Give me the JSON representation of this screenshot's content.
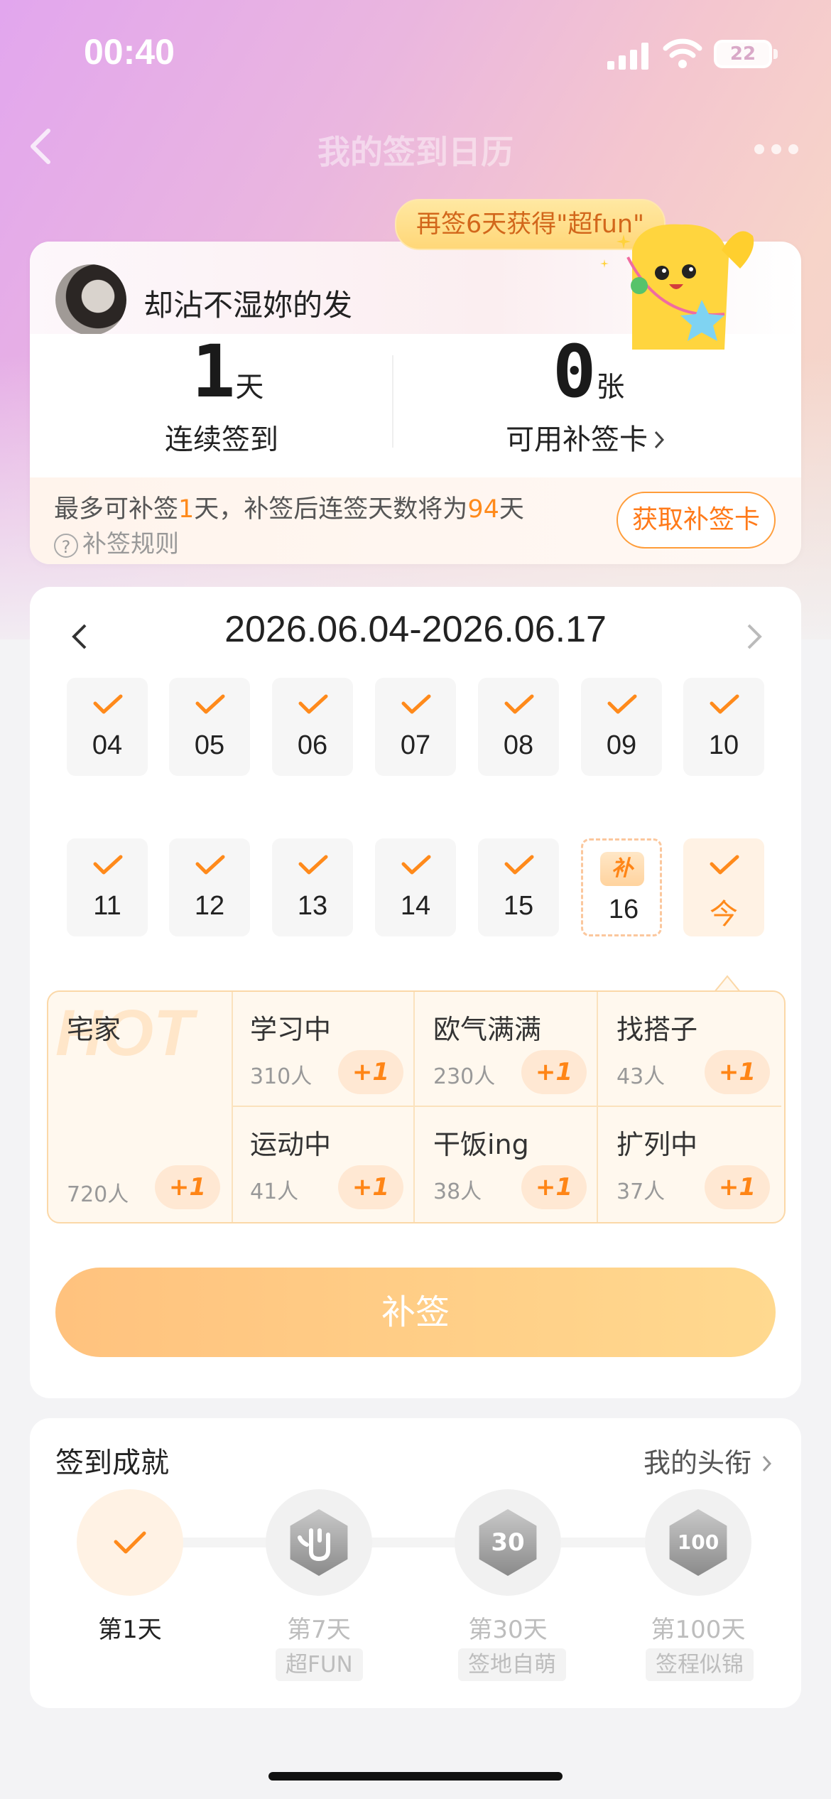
{
  "status_bar": {
    "time": "00:40",
    "battery": "22"
  },
  "nav": {
    "title": "我的签到日历"
  },
  "banner": {
    "tip": "再签6天获得\"超fun\""
  },
  "profile": {
    "username": "却沾不湿妳的发",
    "streak_value": "1",
    "streak_unit": "天",
    "streak_label": "连续签到",
    "cards_value": "0",
    "cards_unit": "张",
    "cards_label": "可用补签卡",
    "repair_pre": "最多可补签",
    "repair_days": "1",
    "repair_mid": "天，补签后连签天数将为",
    "repair_total": "94",
    "repair_post": "天",
    "rule_label": "补签规则",
    "get_card_button": "获取补签卡"
  },
  "calendar": {
    "range": "2026.06.04-2026.06.17",
    "week1": [
      "04",
      "05",
      "06",
      "07",
      "08",
      "09",
      "10"
    ],
    "week2": [
      "11",
      "12",
      "13",
      "14",
      "15"
    ],
    "missing_day": "16",
    "missing_badge": "补",
    "today_label": "今"
  },
  "tags": {
    "hot_word": "HOT",
    "hot": {
      "name": "宅家",
      "count": "720人"
    },
    "items": [
      {
        "name": "学习中",
        "count": "310人"
      },
      {
        "name": "欧气满满",
        "count": "230人"
      },
      {
        "name": "找搭子",
        "count": "43人"
      },
      {
        "name": "运动中",
        "count": "41人"
      },
      {
        "name": "干饭ing",
        "count": "38人"
      },
      {
        "name": "扩列中",
        "count": "37人"
      }
    ],
    "plus_label": "+1"
  },
  "buqian_button": "补签",
  "achievements": {
    "title": "签到成就",
    "link": "我的头衔",
    "items": [
      {
        "day": "第1天",
        "name": ""
      },
      {
        "day": "第7天",
        "name": "超FUN"
      },
      {
        "day": "第30天",
        "name": "签地自萌",
        "badge": "30"
      },
      {
        "day": "第100天",
        "name": "签程似锦",
        "badge": "100"
      }
    ]
  },
  "colors": {
    "accent": "#ff8a1b",
    "button_gradient_start": "#ffc27e",
    "button_gradient_end": "#ffd98f"
  }
}
